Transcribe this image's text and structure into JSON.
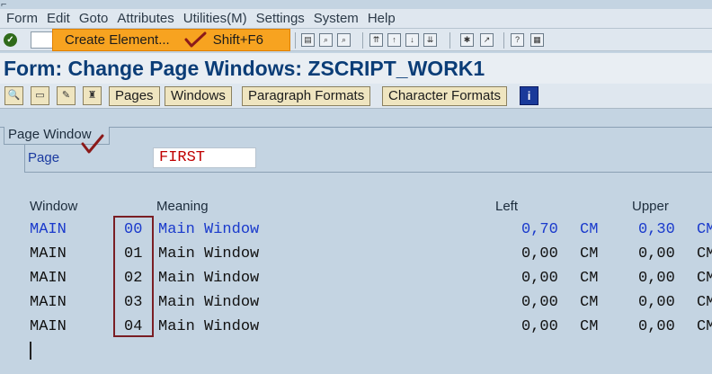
{
  "menu": [
    "Form",
    "Edit",
    "Goto",
    "Attributes",
    "Utilities(M)",
    "Settings",
    "System",
    "Help"
  ],
  "context_menu": {
    "item_label": "Create Element...",
    "shortcut": "Shift+F6"
  },
  "title": "Form: Change Page Windows: ZSCRIPT_WORK1",
  "app_toolbar": {
    "buttons": [
      "Pages",
      "Windows",
      "Paragraph Formats",
      "Character Formats"
    ]
  },
  "tab_label": "Page Window",
  "page": {
    "label": "Page",
    "value": "FIRST"
  },
  "columns": {
    "window": "Window",
    "meaning": "Meaning",
    "left": "Left",
    "upper": "Upper"
  },
  "rows": [
    {
      "window": "MAIN",
      "id": "00",
      "meaning": "Main Window",
      "left": "0,70",
      "left_unit": "CM",
      "upper": "0,30",
      "upper_unit": "CM",
      "selected": true
    },
    {
      "window": "MAIN",
      "id": "01",
      "meaning": "Main Window",
      "left": "0,00",
      "left_unit": "CM",
      "upper": "0,00",
      "upper_unit": "CM"
    },
    {
      "window": "MAIN",
      "id": "02",
      "meaning": "Main Window",
      "left": "0,00",
      "left_unit": "CM",
      "upper": "0,00",
      "upper_unit": "CM"
    },
    {
      "window": "MAIN",
      "id": "03",
      "meaning": "Main Window",
      "left": "0,00",
      "left_unit": "CM",
      "upper": "0,00",
      "upper_unit": "CM"
    },
    {
      "window": "MAIN",
      "id": "04",
      "meaning": "Main Window",
      "left": "0,00",
      "left_unit": "CM",
      "upper": "0,00",
      "upper_unit": "CM"
    }
  ],
  "colors": {
    "title": "#0b3d77",
    "selected_row": "#1a3acc",
    "page_value": "#c00000",
    "popup": "#f7a320",
    "annotation": "#8b1a1a"
  }
}
